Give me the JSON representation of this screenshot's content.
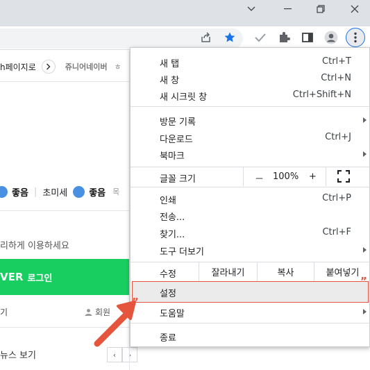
{
  "window": {
    "icons": [
      "chevron-down-icon",
      "minimize-icon",
      "restore-icon",
      "close-icon"
    ]
  },
  "toolbar": {
    "icons": [
      "share-icon",
      "bookmark-star-icon",
      "check-icon",
      "extensions-icon",
      "side-panel-icon",
      "profile-icon",
      "more-menu-icon"
    ]
  },
  "page": {
    "news_link_text": "h페이지로",
    "junior_naver": "쥬니어네이버",
    "junior_tail": "ㅎ",
    "dust_status": "좋음",
    "ultrafine_label": "초미세",
    "ultrafine_status": "좋음",
    "dust_tail": "목",
    "login_hint": "리하게 이용하세요",
    "naver_logo_text": "VER",
    "login_label": "로그인",
    "sub_left": "기",
    "sub_right": "회원",
    "news_view": "뉴스 보기",
    "pager_prev": "‹",
    "pager_next": "›"
  },
  "menu": {
    "new_tab": {
      "label": "새 탭",
      "shortcut": "Ctrl+T"
    },
    "new_window": {
      "label": "새 창",
      "shortcut": "Ctrl+N"
    },
    "incognito": {
      "label": "새 시크릿 창",
      "shortcut": "Ctrl+Shift+N"
    },
    "history": {
      "label": "방문 기록"
    },
    "downloads": {
      "label": "다운로드",
      "shortcut": "Ctrl+J"
    },
    "bookmarks": {
      "label": "북마크"
    },
    "zoom": {
      "label": "글꼴 크기",
      "minus": "－",
      "value": "100%",
      "plus": "+"
    },
    "print": {
      "label": "인쇄",
      "shortcut": "Ctrl+P"
    },
    "cast": {
      "label": "전송..."
    },
    "find": {
      "label": "찾기...",
      "shortcut": "Ctrl+F"
    },
    "more_tools": {
      "label": "도구 더보기"
    },
    "edit": {
      "label": "수정",
      "cut": "잘라내기",
      "copy": "복사",
      "paste": "붙여넣기"
    },
    "settings": {
      "label": "설정"
    },
    "help": {
      "label": "도움말"
    },
    "exit": {
      "label": "종료"
    }
  },
  "annotation": {
    "quote_left": "”",
    "quote_right": "”",
    "arrow_color": "#e5553d"
  },
  "colors": {
    "accent": "#1a73e8",
    "naver_green": "#19ce60",
    "highlight_border": "#e5553d"
  }
}
